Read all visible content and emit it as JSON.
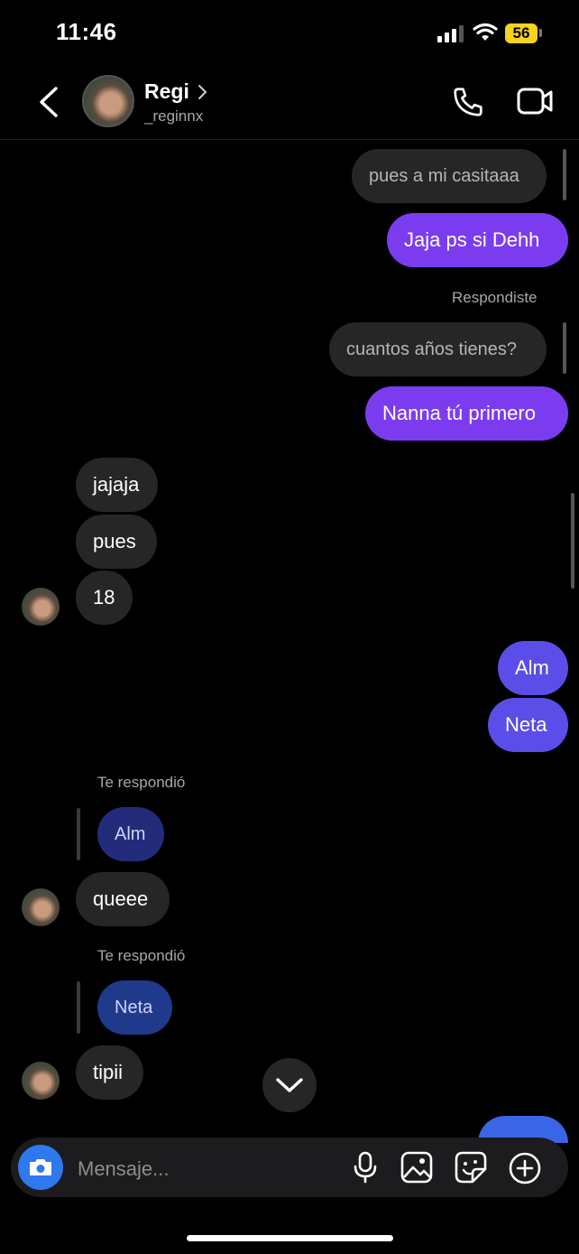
{
  "status_bar": {
    "time": "11:46",
    "battery": "56"
  },
  "header": {
    "name": "Regi",
    "handle": "_reginnx"
  },
  "messages": {
    "m1": "pues a mi casitaaa",
    "m2": "Jaja ps si Dehh",
    "reply_label_1": "Respondiste",
    "m3": "cuantos años tienes?",
    "m4": "Nanna tú primero",
    "m5": "jajaja",
    "m6": "pues",
    "m7": "18",
    "m8": "Alm",
    "m9": "Neta",
    "reply_label_2": "Te respondió",
    "quote_1": "Alm",
    "m10": "queee",
    "reply_label_3": "Te respondió",
    "quote_2": "Neta",
    "m11": "tipii"
  },
  "composer": {
    "placeholder": "Mensaje..."
  },
  "colors": {
    "outgoing": "#7b3cf0",
    "incoming": "#262626",
    "camera": "#2f78ee"
  }
}
